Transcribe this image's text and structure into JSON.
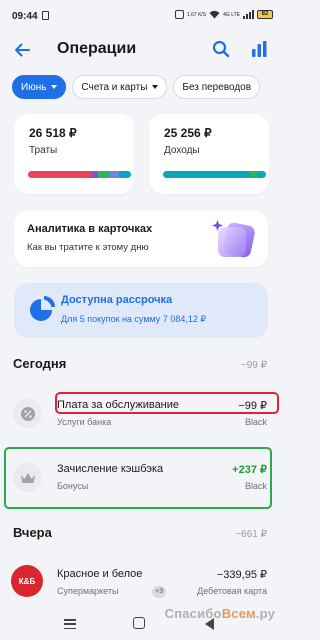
{
  "status_bar": {
    "time": "09:44",
    "network_speed": "1,67 K/S",
    "network_type": "4G LTE",
    "battery": "82"
  },
  "header": {
    "title": "Операции",
    "icons": [
      "back-arrow-icon",
      "search-icon",
      "bar-chart-icon"
    ]
  },
  "filters": {
    "month": "Июнь",
    "accounts": "Счета и карты",
    "transfers": "Без переводов"
  },
  "summary": {
    "expenses": {
      "amount": "26 518 ₽",
      "label": "Траты"
    },
    "income": {
      "amount": "25 256 ₽",
      "label": "Доходы"
    },
    "colors": {
      "expenses_bar": [
        "#e8455a",
        "#8a4fd8",
        "#2fb56a",
        "#6f8bd8",
        "#0aa7b8"
      ],
      "income_bar": [
        "#0aa7b8",
        "#2fb56a"
      ]
    }
  },
  "analytics": {
    "title": "Аналитика в карточках",
    "subtitle": "Как вы тратите к этому дню"
  },
  "installment": {
    "title": "Доступна рассрочка",
    "subtitle": "Для 5 покупок на сумму 7 084,12 ₽"
  },
  "sections": [
    {
      "title": "Сегодня",
      "total": "−99 ₽",
      "operations": [
        {
          "name": "Плата за обслуживание",
          "category": "Услуги банка",
          "amount": "−99 ₽",
          "card": "Black",
          "icon": "percent-icon"
        },
        {
          "name": "Зачисление кэшбэка",
          "category": "Бонусы",
          "amount": "+237 ₽",
          "card": "Black",
          "icon": "crown-icon"
        }
      ]
    },
    {
      "title": "Вчера",
      "total": "−661 ₽",
      "operations": [
        {
          "name": "Красное и белое",
          "category": "Супермаркеты",
          "amount": "−339,95 ₽",
          "card": "Дебетовая карта",
          "badge": "+3",
          "logo": "К&Б"
        }
      ]
    }
  ],
  "watermark": {
    "part1": "Спасибо",
    "part2": "Всем",
    "part3": ".ру"
  },
  "colors": {
    "accent": "#1f6fe6",
    "positive": "#1f9a3a",
    "highlight_red": "#e02436",
    "highlight_green": "#2ea84a",
    "background": "#f3f4f8"
  }
}
